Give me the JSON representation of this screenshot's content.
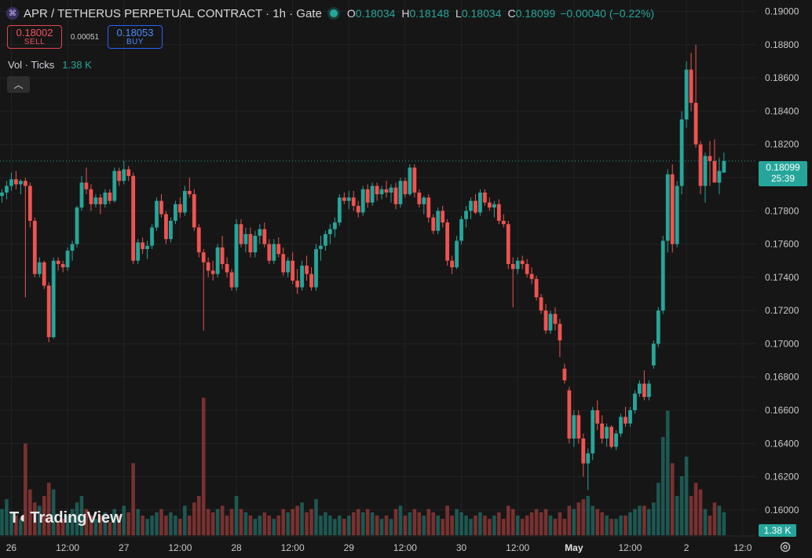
{
  "header": {
    "symbol_icon": "apr-token-icon",
    "title": "APR / TETHERUS PERPETUAL CONTRACT · 1h · Gate",
    "ohlc": [
      {
        "key": "O",
        "value": "0.18034"
      },
      {
        "key": "H",
        "value": "0.18148"
      },
      {
        "key": "L",
        "value": "0.18034"
      },
      {
        "key": "C",
        "value": "0.18099"
      }
    ],
    "change": "−0.00040 (−0.22%)"
  },
  "trade": {
    "sell_price": "0.18002",
    "sell_label": "SELL",
    "spread": "0.00051",
    "buy_price": "0.18053",
    "buy_label": "BUY"
  },
  "volume_legend": {
    "label": "Vol · Ticks",
    "value": "1.38 K"
  },
  "logo": {
    "text": "TradingView"
  },
  "last_price": {
    "price": "0.18099",
    "countdown": "25:39"
  },
  "volume_tag": "1.38 K",
  "colors": {
    "up": "#26a69a",
    "down": "#ef5350",
    "background": "#161616",
    "grid": "#232323",
    "text": "#d1d4dc"
  },
  "chart_data": {
    "type": "candlestick",
    "y_axis": {
      "range": [
        0.159,
        0.1905
      ],
      "ticks": [
        "0.19000",
        "0.18800",
        "0.18600",
        "0.18400",
        "0.18200",
        "0.18000",
        "0.17800",
        "0.17600",
        "0.17400",
        "0.17200",
        "0.17000",
        "0.16800",
        "0.16600",
        "0.16400",
        "0.16200",
        "0.16000"
      ]
    },
    "x_axis": {
      "ticks": [
        {
          "label": "26",
          "i": 2
        },
        {
          "label": "12:00",
          "i": 14
        },
        {
          "label": "27",
          "i": 26
        },
        {
          "label": "12:00",
          "i": 38
        },
        {
          "label": "28",
          "i": 50
        },
        {
          "label": "12:00",
          "i": 62
        },
        {
          "label": "29",
          "i": 74
        },
        {
          "label": "12:00",
          "i": 86
        },
        {
          "label": "30",
          "i": 98
        },
        {
          "label": "12:00",
          "i": 110
        },
        {
          "label": "May",
          "i": 122
        },
        {
          "label": "12:00",
          "i": 134
        },
        {
          "label": "2",
          "i": 146
        },
        {
          "label": "12:0",
          "i": 158
        }
      ]
    },
    "candles": [
      [
        0.1789,
        0.1793,
        0.1785,
        0.1791,
        40
      ],
      [
        0.1791,
        0.1798,
        0.1787,
        0.1795,
        55
      ],
      [
        0.1795,
        0.1803,
        0.1792,
        0.1799,
        35
      ],
      [
        0.1799,
        0.1804,
        0.1793,
        0.1796,
        30
      ],
      [
        0.1796,
        0.1799,
        0.179,
        0.1798,
        25
      ],
      [
        0.1798,
        0.18,
        0.1728,
        0.1795,
        140
      ],
      [
        0.1795,
        0.1797,
        0.177,
        0.1774,
        70
      ],
      [
        0.1774,
        0.1776,
        0.174,
        0.1742,
        50
      ],
      [
        0.1742,
        0.1752,
        0.174,
        0.1749,
        45
      ],
      [
        0.1749,
        0.175,
        0.1733,
        0.1735,
        60
      ],
      [
        0.1735,
        0.1737,
        0.1701,
        0.1704,
        80
      ],
      [
        0.1704,
        0.1752,
        0.1703,
        0.175,
        70
      ],
      [
        0.175,
        0.1752,
        0.1744,
        0.1748,
        20
      ],
      [
        0.1748,
        0.175,
        0.1743,
        0.1746,
        25
      ],
      [
        0.1746,
        0.1758,
        0.1744,
        0.1756,
        30
      ],
      [
        0.1756,
        0.1762,
        0.175,
        0.176,
        40
      ],
      [
        0.176,
        0.1783,
        0.1758,
        0.1782,
        50
      ],
      [
        0.1782,
        0.1801,
        0.178,
        0.1797,
        60
      ],
      [
        0.1797,
        0.1806,
        0.179,
        0.1793,
        40
      ],
      [
        0.1793,
        0.1796,
        0.178,
        0.1784,
        30
      ],
      [
        0.1784,
        0.179,
        0.1782,
        0.1788,
        25
      ],
      [
        0.1788,
        0.179,
        0.1778,
        0.1784,
        30
      ],
      [
        0.1784,
        0.1793,
        0.1782,
        0.1791,
        35
      ],
      [
        0.1791,
        0.1793,
        0.1784,
        0.1786,
        20
      ],
      [
        0.1786,
        0.1806,
        0.1785,
        0.1804,
        40
      ],
      [
        0.1804,
        0.1806,
        0.1795,
        0.1798,
        30
      ],
      [
        0.1798,
        0.181,
        0.1796,
        0.1805,
        45
      ],
      [
        0.1805,
        0.1807,
        0.1798,
        0.1801,
        35
      ],
      [
        0.1801,
        0.1803,
        0.1748,
        0.175,
        110
      ],
      [
        0.175,
        0.1763,
        0.1748,
        0.1761,
        40
      ],
      [
        0.1761,
        0.1764,
        0.1754,
        0.1757,
        30
      ],
      [
        0.1757,
        0.1762,
        0.1751,
        0.1759,
        25
      ],
      [
        0.1759,
        0.1772,
        0.1757,
        0.177,
        30
      ],
      [
        0.177,
        0.1788,
        0.1768,
        0.1786,
        35
      ],
      [
        0.1786,
        0.179,
        0.1776,
        0.1778,
        40
      ],
      [
        0.1778,
        0.178,
        0.176,
        0.1763,
        30
      ],
      [
        0.1763,
        0.1776,
        0.1761,
        0.1774,
        35
      ],
      [
        0.1774,
        0.1786,
        0.1772,
        0.1784,
        30
      ],
      [
        0.1784,
        0.1788,
        0.1776,
        0.1779,
        25
      ],
      [
        0.1779,
        0.1795,
        0.1777,
        0.1792,
        45
      ],
      [
        0.1792,
        0.18,
        0.1788,
        0.179,
        30
      ],
      [
        0.179,
        0.1793,
        0.1768,
        0.177,
        50
      ],
      [
        0.177,
        0.1772,
        0.1752,
        0.1755,
        60
      ],
      [
        0.1755,
        0.1757,
        0.1708,
        0.1749,
        210
      ],
      [
        0.1749,
        0.1752,
        0.174,
        0.1744,
        40
      ],
      [
        0.1744,
        0.175,
        0.1738,
        0.1742,
        35
      ],
      [
        0.1742,
        0.176,
        0.174,
        0.1758,
        40
      ],
      [
        0.1758,
        0.1765,
        0.1745,
        0.1748,
        45
      ],
      [
        0.1748,
        0.1752,
        0.174,
        0.1743,
        30
      ],
      [
        0.1743,
        0.1745,
        0.1732,
        0.1734,
        40
      ],
      [
        0.1734,
        0.1775,
        0.1732,
        0.1772,
        60
      ],
      [
        0.1772,
        0.1775,
        0.1758,
        0.176,
        40
      ],
      [
        0.176,
        0.177,
        0.1755,
        0.1766,
        35
      ],
      [
        0.1766,
        0.177,
        0.1752,
        0.1755,
        30
      ],
      [
        0.1755,
        0.1768,
        0.1752,
        0.1765,
        25
      ],
      [
        0.1765,
        0.1772,
        0.176,
        0.1769,
        30
      ],
      [
        0.1769,
        0.1773,
        0.1758,
        0.176,
        35
      ],
      [
        0.176,
        0.1763,
        0.1748,
        0.175,
        30
      ],
      [
        0.175,
        0.1763,
        0.1748,
        0.176,
        25
      ],
      [
        0.176,
        0.1764,
        0.1752,
        0.1754,
        30
      ],
      [
        0.1754,
        0.1758,
        0.1741,
        0.1743,
        40
      ],
      [
        0.1743,
        0.1752,
        0.174,
        0.175,
        35
      ],
      [
        0.175,
        0.1755,
        0.1736,
        0.1738,
        40
      ],
      [
        0.1738,
        0.1745,
        0.173,
        0.1734,
        45
      ],
      [
        0.1734,
        0.175,
        0.1732,
        0.1747,
        50
      ],
      [
        0.1747,
        0.1753,
        0.1738,
        0.1742,
        35
      ],
      [
        0.1742,
        0.1746,
        0.1732,
        0.1734,
        40
      ],
      [
        0.1734,
        0.176,
        0.1732,
        0.1757,
        55
      ],
      [
        0.1757,
        0.1765,
        0.175,
        0.1759,
        30
      ],
      [
        0.1759,
        0.1768,
        0.1756,
        0.1766,
        35
      ],
      [
        0.1766,
        0.1772,
        0.176,
        0.1769,
        30
      ],
      [
        0.1769,
        0.1776,
        0.1764,
        0.1773,
        25
      ],
      [
        0.1773,
        0.179,
        0.1771,
        0.1788,
        30
      ],
      [
        0.1788,
        0.1791,
        0.1784,
        0.1786,
        25
      ],
      [
        0.1786,
        0.1792,
        0.1781,
        0.1788,
        30
      ],
      [
        0.1788,
        0.1792,
        0.178,
        0.1783,
        35
      ],
      [
        0.1783,
        0.1786,
        0.1776,
        0.1779,
        40
      ],
      [
        0.1779,
        0.1795,
        0.1777,
        0.1793,
        35
      ],
      [
        0.1793,
        0.1796,
        0.1782,
        0.1785,
        40
      ],
      [
        0.1785,
        0.1797,
        0.1783,
        0.1795,
        35
      ],
      [
        0.1795,
        0.1797,
        0.1786,
        0.179,
        30
      ],
      [
        0.179,
        0.1795,
        0.1787,
        0.1793,
        25
      ],
      [
        0.1793,
        0.1798,
        0.1788,
        0.1791,
        30
      ],
      [
        0.1791,
        0.1796,
        0.1785,
        0.1794,
        25
      ],
      [
        0.1794,
        0.1797,
        0.1781,
        0.1784,
        40
      ],
      [
        0.1784,
        0.18,
        0.1782,
        0.1798,
        45
      ],
      [
        0.1798,
        0.18,
        0.1788,
        0.179,
        30
      ],
      [
        0.179,
        0.1808,
        0.1789,
        0.1806,
        35
      ],
      [
        0.1806,
        0.1808,
        0.1788,
        0.1791,
        40
      ],
      [
        0.1791,
        0.1793,
        0.1782,
        0.1784,
        35
      ],
      [
        0.1784,
        0.1789,
        0.1778,
        0.1788,
        30
      ],
      [
        0.1788,
        0.179,
        0.1773,
        0.1776,
        40
      ],
      [
        0.1776,
        0.1778,
        0.1766,
        0.1768,
        35
      ],
      [
        0.1768,
        0.1782,
        0.1766,
        0.178,
        30
      ],
      [
        0.178,
        0.1783,
        0.177,
        0.1773,
        25
      ],
      [
        0.1773,
        0.1775,
        0.1747,
        0.175,
        45
      ],
      [
        0.175,
        0.1753,
        0.1742,
        0.1746,
        30
      ],
      [
        0.1746,
        0.1765,
        0.1745,
        0.1762,
        40
      ],
      [
        0.1762,
        0.1777,
        0.176,
        0.1775,
        35
      ],
      [
        0.1775,
        0.1783,
        0.177,
        0.178,
        30
      ],
      [
        0.178,
        0.1788,
        0.1775,
        0.1786,
        25
      ],
      [
        0.1786,
        0.179,
        0.1778,
        0.1779,
        30
      ],
      [
        0.1779,
        0.1793,
        0.1777,
        0.1791,
        35
      ],
      [
        0.1791,
        0.1793,
        0.1783,
        0.1785,
        30
      ],
      [
        0.1785,
        0.1788,
        0.178,
        0.1782,
        25
      ],
      [
        0.1782,
        0.1786,
        0.1776,
        0.1784,
        30
      ],
      [
        0.1784,
        0.1787,
        0.1772,
        0.1774,
        35
      ],
      [
        0.1774,
        0.1778,
        0.177,
        0.1772,
        25
      ],
      [
        0.1772,
        0.1774,
        0.1745,
        0.1748,
        45
      ],
      [
        0.1748,
        0.1752,
        0.1722,
        0.1745,
        40
      ],
      [
        0.1745,
        0.1752,
        0.1742,
        0.175,
        30
      ],
      [
        0.175,
        0.1753,
        0.1745,
        0.1748,
        25
      ],
      [
        0.1748,
        0.1751,
        0.174,
        0.1742,
        30
      ],
      [
        0.1742,
        0.1746,
        0.1736,
        0.1739,
        35
      ],
      [
        0.1739,
        0.1741,
        0.1726,
        0.1728,
        40
      ],
      [
        0.1728,
        0.173,
        0.1718,
        0.172,
        35
      ],
      [
        0.172,
        0.1724,
        0.1706,
        0.1708,
        40
      ],
      [
        0.1708,
        0.172,
        0.1706,
        0.1718,
        30
      ],
      [
        0.1718,
        0.1722,
        0.1708,
        0.1712,
        25
      ],
      [
        0.1712,
        0.1715,
        0.1692,
        0.1702,
        35
      ],
      [
        0.1685,
        0.1688,
        0.1676,
        0.1678,
        25
      ],
      [
        0.1672,
        0.1674,
        0.164,
        0.1643,
        45
      ],
      [
        0.1643,
        0.166,
        0.1638,
        0.1657,
        40
      ],
      [
        0.1657,
        0.166,
        0.164,
        0.1643,
        50
      ],
      [
        0.1643,
        0.1646,
        0.162,
        0.1628,
        55
      ],
      [
        0.1628,
        0.1637,
        0.1612,
        0.1634,
        60
      ],
      [
        0.1634,
        0.1662,
        0.163,
        0.166,
        45
      ],
      [
        0.166,
        0.1666,
        0.1648,
        0.1652,
        40
      ],
      [
        0.1652,
        0.1657,
        0.164,
        0.1643,
        35
      ],
      [
        0.1643,
        0.1652,
        0.1638,
        0.165,
        30
      ],
      [
        0.165,
        0.1651,
        0.1637,
        0.1638,
        25
      ],
      [
        0.1638,
        0.1648,
        0.1636,
        0.1646,
        25
      ],
      [
        0.1646,
        0.1658,
        0.1644,
        0.1656,
        30
      ],
      [
        0.1656,
        0.1662,
        0.165,
        0.1652,
        30
      ],
      [
        0.1652,
        0.1662,
        0.165,
        0.166,
        35
      ],
      [
        0.166,
        0.1672,
        0.1658,
        0.167,
        40
      ],
      [
        0.167,
        0.1678,
        0.1668,
        0.1676,
        45
      ],
      [
        0.1676,
        0.1684,
        0.1666,
        0.1668,
        45
      ],
      [
        0.1668,
        0.1678,
        0.1666,
        0.1676,
        40
      ],
      [
        0.1687,
        0.1702,
        0.1685,
        0.17,
        50
      ],
      [
        0.17,
        0.1722,
        0.1698,
        0.172,
        80
      ],
      [
        0.172,
        0.1765,
        0.1718,
        0.1762,
        150
      ],
      [
        0.1762,
        0.1805,
        0.1755,
        0.1802,
        190
      ],
      [
        0.1802,
        0.1808,
        0.1755,
        0.176,
        110
      ],
      [
        0.176,
        0.1798,
        0.1758,
        0.1795,
        60
      ],
      [
        0.1795,
        0.184,
        0.179,
        0.1835,
        90
      ],
      [
        0.1835,
        0.187,
        0.183,
        0.1865,
        120
      ],
      [
        0.1865,
        0.1875,
        0.184,
        0.1845,
        60
      ],
      [
        0.1845,
        0.188,
        0.1818,
        0.182,
        80
      ],
      [
        0.182,
        0.1822,
        0.179,
        0.1795,
        70
      ],
      [
        0.1795,
        0.1815,
        0.1785,
        0.1813,
        40
      ],
      [
        0.1813,
        0.1822,
        0.1795,
        0.181,
        30
      ],
      [
        0.181,
        0.1823,
        0.18,
        0.1797,
        50
      ],
      [
        0.1797,
        0.1812,
        0.179,
        0.1804,
        45
      ],
      [
        0.1803,
        0.1815,
        0.1803,
        0.181,
        35
      ]
    ]
  }
}
